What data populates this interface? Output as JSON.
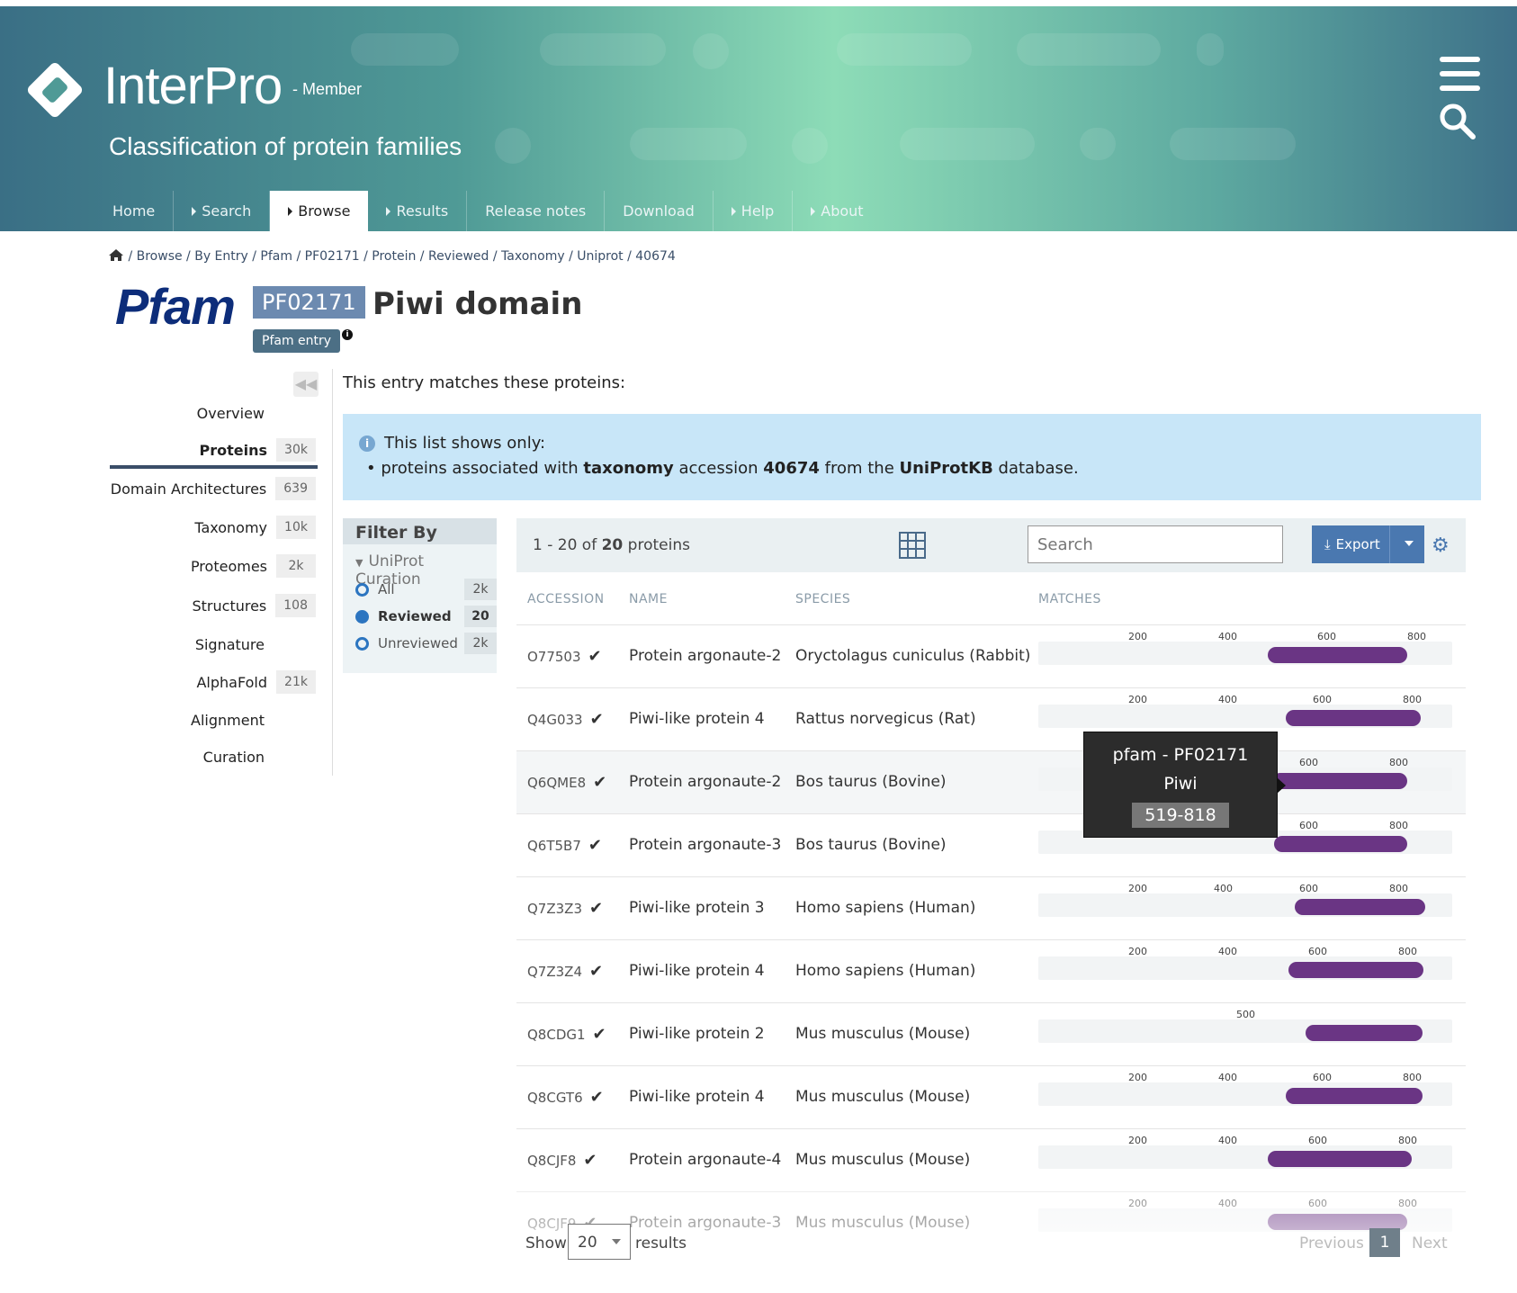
{
  "header": {
    "brand": "InterPro",
    "member": "- Member",
    "subtitle": "Classification of protein families"
  },
  "nav": [
    "Home",
    "Search",
    "Browse",
    "Results",
    "Release notes",
    "Download",
    "Help",
    "About"
  ],
  "breadcrumb": "/ Browse / By Entry / Pfam / PF02171 / Protein / Reviewed / Taxonomy / Uniprot / 40674",
  "entry": {
    "db_logo": "Pfam",
    "accession": "PF02171",
    "title": "Piwi domain",
    "type": "Pfam entry"
  },
  "sidebar": {
    "items": [
      {
        "label": "Overview",
        "count": ""
      },
      {
        "label": "Proteins",
        "count": "30k"
      },
      {
        "label": "Domain Architectures",
        "count": "639"
      },
      {
        "label": "Taxonomy",
        "count": "10k"
      },
      {
        "label": "Proteomes",
        "count": "2k"
      },
      {
        "label": "Structures",
        "count": "108"
      },
      {
        "label": "Signature",
        "count": ""
      },
      {
        "label": "AlphaFold",
        "count": "21k"
      },
      {
        "label": "Alignment",
        "count": ""
      },
      {
        "label": "Curation",
        "count": ""
      }
    ]
  },
  "intro": "This entry matches these proteins:",
  "callout": {
    "heading": "This list shows only:",
    "p1": "proteins associated with ",
    "b1": "taxonomy",
    "p2": " accession ",
    "b2": "40674",
    "p3": " from the ",
    "b3": "UniProtKB",
    "p4": " database."
  },
  "filter": {
    "title": "Filter By",
    "section": "UniProt Curation",
    "options": [
      {
        "label": "All",
        "count": "2k"
      },
      {
        "label": "Reviewed",
        "count": "20"
      },
      {
        "label": "Unreviewed",
        "count": "2k"
      }
    ]
  },
  "table": {
    "range": "1 - 20 of ",
    "total": "20",
    "unit": " proteins",
    "search_placeholder": "Search",
    "export_label": "Export",
    "columns": [
      "ACCESSION",
      "NAME",
      "SPECIES",
      "MATCHES"
    ],
    "rows": [
      {
        "acc": "O77503",
        "name": "Protein argonaute-2",
        "species": "Oryctolagus cuniculus (Rabbit)",
        "ticks": [
          "200",
          "400",
          "600",
          "800"
        ]
      },
      {
        "acc": "Q4G033",
        "name": "Piwi-like protein 4",
        "species": "Rattus norvegicus (Rat)",
        "ticks": [
          "200",
          "400",
          "600",
          "800"
        ]
      },
      {
        "acc": "Q6QME8",
        "name": "Protein argonaute-2",
        "species": "Bos taurus (Bovine)",
        "ticks": [
          "600",
          "800"
        ]
      },
      {
        "acc": "Q6T5B7",
        "name": "Protein argonaute-3",
        "species": "Bos taurus (Bovine)",
        "ticks": [
          "600",
          "800"
        ]
      },
      {
        "acc": "Q7Z3Z3",
        "name": "Piwi-like protein 3",
        "species": "Homo sapiens (Human)",
        "ticks": [
          "200",
          "400",
          "600",
          "800"
        ]
      },
      {
        "acc": "Q7Z3Z4",
        "name": "Piwi-like protein 4",
        "species": "Homo sapiens (Human)",
        "ticks": [
          "200",
          "400",
          "600",
          "800"
        ]
      },
      {
        "acc": "Q8CDG1",
        "name": "Piwi-like protein 2",
        "species": "Mus musculus (Mouse)",
        "ticks": [
          "500"
        ]
      },
      {
        "acc": "Q8CGT6",
        "name": "Piwi-like protein 4",
        "species": "Mus musculus (Mouse)",
        "ticks": [
          "200",
          "400",
          "600",
          "800"
        ]
      },
      {
        "acc": "Q8CJF8",
        "name": "Protein argonaute-4",
        "species": "Mus musculus (Mouse)",
        "ticks": [
          "200",
          "400",
          "600",
          "800"
        ]
      },
      {
        "acc": "Q8CJF9",
        "name": "Protein argonaute-3",
        "species": "Mus musculus (Mouse)",
        "ticks": [
          "200",
          "400",
          "600",
          "800"
        ]
      }
    ]
  },
  "tooltip": {
    "line1": "pfam - PF02171",
    "line2": "Piwi",
    "range": "519-818"
  },
  "pager": {
    "show": "Show",
    "per_page": "20",
    "results": "results",
    "prev": "Previous",
    "page": "1",
    "next": "Next"
  },
  "colors": {
    "match_bar": "#6a3584",
    "callout_bg": "#c8e6f8",
    "export_btn": "#4a78b0"
  }
}
